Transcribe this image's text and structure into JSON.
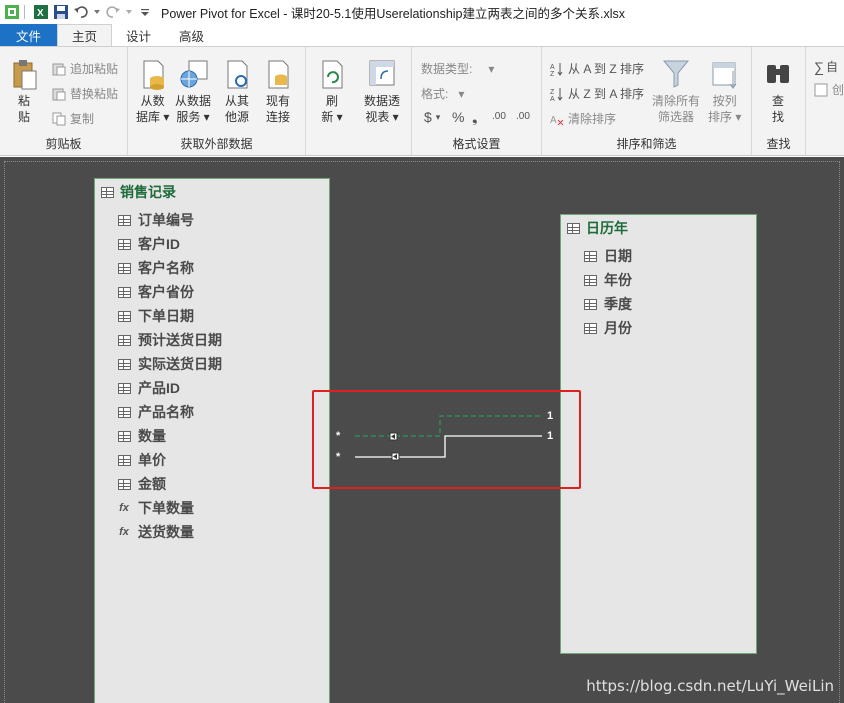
{
  "window": {
    "title": "Power Pivot for Excel - 课时20-5.1使用Userelationship建立两表之间的多个关系.xlsx"
  },
  "tabs": [
    {
      "label": "文件"
    },
    {
      "label": "主页"
    },
    {
      "label": "设计"
    },
    {
      "label": "高级"
    }
  ],
  "ribbon": {
    "clipboard": {
      "label": "剪贴板",
      "paste": "粘\n贴",
      "paste_l1": "粘",
      "paste_l2": "贴",
      "append_paste": "追加粘贴",
      "replace_paste": "替换粘贴",
      "copy": "复制"
    },
    "external": {
      "label": "获取外部数据",
      "from_db_l1": "从数",
      "from_db_l2": "据库",
      "from_service_l1": "从数据",
      "from_service_l2": "服务",
      "from_other_l1": "从其",
      "from_other_l2": "他源",
      "existing_l1": "现有",
      "existing_l2": "连接"
    },
    "refresh": {
      "l1": "刷",
      "l2": "新"
    },
    "pivot": {
      "l1": "数据透",
      "l2": "视表"
    },
    "format": {
      "label": "格式设置",
      "data_type": "数据类型:",
      "format": "格式:",
      "currency": "$",
      "percent": "%",
      "comma": "❟",
      "inc_dec": ".00",
      "dec_dec": ".00"
    },
    "sort": {
      "label": "排序和筛选",
      "a_to_z": "从 A 到 Z 排序",
      "z_to_a": "从 Z 到 A 排序",
      "clear_sort": "清除排序",
      "clear_filters_l1": "清除所有",
      "clear_filters_l2": "筛选器",
      "sort_by_col_l1": "按列",
      "sort_by_col_l2": "排序"
    },
    "find": {
      "label": "查找",
      "l1": "查",
      "l2": "找"
    },
    "calc": {
      "auto": "自",
      "create": "创"
    }
  },
  "tables": [
    {
      "name": "销售记录",
      "fields": [
        {
          "name": "订单编号",
          "icon": "column-icon"
        },
        {
          "name": "客户ID",
          "icon": "column-icon"
        },
        {
          "name": "客户名称",
          "icon": "column-icon"
        },
        {
          "name": "客户省份",
          "icon": "column-icon"
        },
        {
          "name": "下单日期",
          "icon": "column-icon"
        },
        {
          "name": "预计送货日期",
          "icon": "column-icon"
        },
        {
          "name": "实际送货日期",
          "icon": "column-icon"
        },
        {
          "name": "产品ID",
          "icon": "column-icon"
        },
        {
          "name": "产品名称",
          "icon": "column-icon"
        },
        {
          "name": "数量",
          "icon": "column-icon"
        },
        {
          "name": "单价",
          "icon": "column-icon"
        },
        {
          "name": "金额",
          "icon": "column-icon"
        },
        {
          "name": "下单数量",
          "icon": "measure-icon"
        },
        {
          "name": "送货数量",
          "icon": "measure-icon"
        }
      ]
    },
    {
      "name": "日历年",
      "fields": [
        {
          "name": "日期",
          "icon": "column-icon"
        },
        {
          "name": "年份",
          "icon": "column-icon"
        },
        {
          "name": "季度",
          "icon": "column-icon"
        },
        {
          "name": "月份",
          "icon": "column-icon"
        }
      ]
    }
  ],
  "relationships": {
    "many_1": "*",
    "many_2": "*",
    "one_1": "1",
    "one_2": "1"
  },
  "watermark": "https://blog.csdn.net/LuYi_WeiLin",
  "colors": {
    "file_tab": "#1e72c6",
    "canvas": "#4b4b4b",
    "table_header": "#1f6b3a",
    "highlight": "#e02020",
    "inactive_relationship": "#2e7d4f",
    "active_relationship": "#ffffff"
  }
}
